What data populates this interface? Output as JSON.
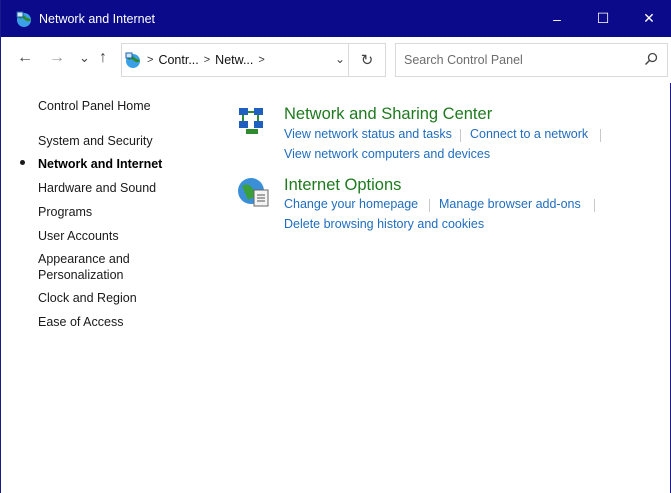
{
  "window": {
    "title": "Network and Internet",
    "controls": {
      "minimize": "–",
      "maximize": "☐",
      "close": "✕"
    }
  },
  "nav": {
    "back": "←",
    "forward": "→",
    "recent": "⌄",
    "up": "↑",
    "breadcrumbs": [
      "Contr...",
      "Netw..."
    ],
    "search_placeholder": "Search Control Panel"
  },
  "sidebar": {
    "items": [
      {
        "label": "Control Panel Home",
        "active": false
      },
      {
        "label": "System and Security",
        "active": false
      },
      {
        "label": "Network and Internet",
        "active": true
      },
      {
        "label": "Hardware and Sound",
        "active": false
      },
      {
        "label": "Programs",
        "active": false
      },
      {
        "label": "User Accounts",
        "active": false
      },
      {
        "label": "Appearance and Personalization",
        "active": false
      },
      {
        "label": "Clock and Region",
        "active": false
      },
      {
        "label": "Ease of Access",
        "active": false
      }
    ],
    "appearance_line1": "Appearance and",
    "appearance_line2": "Personalization"
  },
  "categories": [
    {
      "title": "Network and Sharing Center",
      "icon": "network-sharing-icon",
      "links": [
        "View network status and tasks",
        "Connect to a network",
        "View network computers and devices"
      ]
    },
    {
      "title": "Internet Options",
      "icon": "internet-options-icon",
      "links": [
        "Change your homepage",
        "Manage browser add-ons",
        "Delete browsing history and cookies"
      ]
    }
  ],
  "colors": {
    "titlebar": "#0a0a8a",
    "category_title": "#1e7a1e",
    "link": "#1f6dbf"
  }
}
